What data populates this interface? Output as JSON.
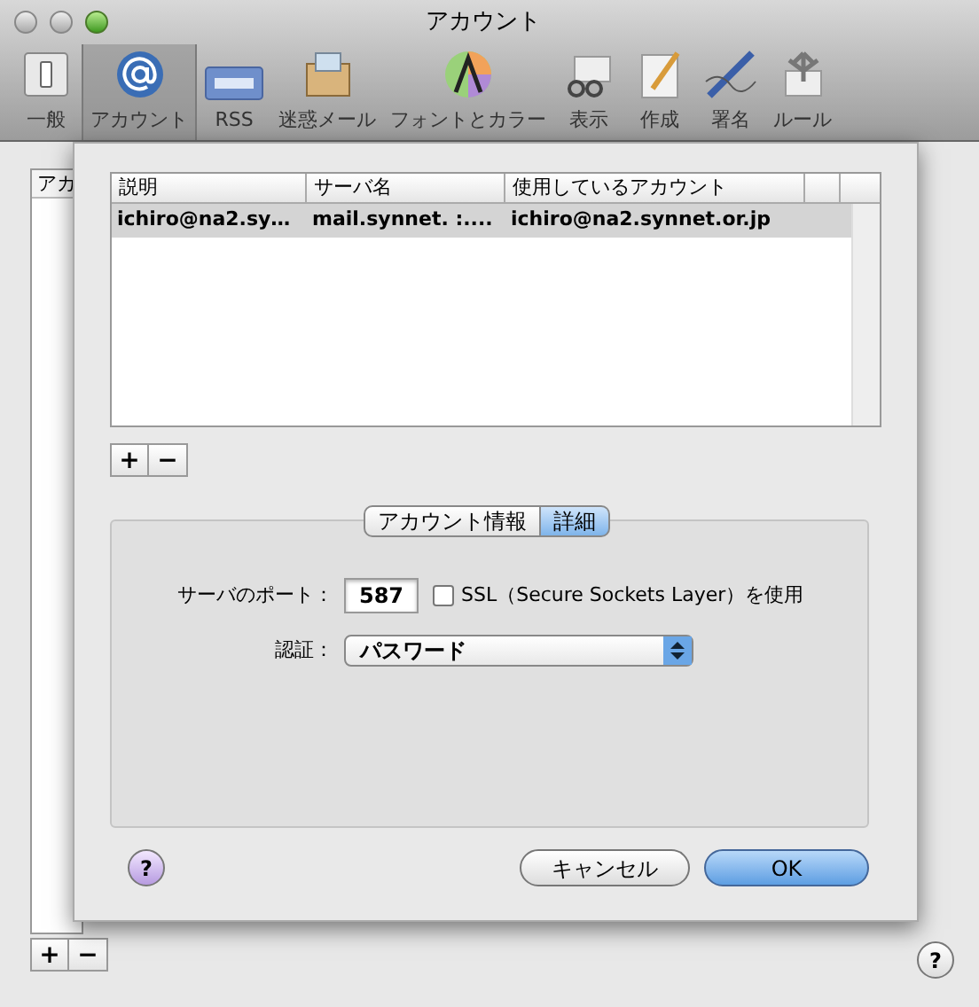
{
  "window": {
    "title": "アカウント"
  },
  "toolbar": [
    {
      "label": "一般",
      "selected": false
    },
    {
      "label": "アカウント",
      "selected": true
    },
    {
      "label": "RSS",
      "selected": false
    },
    {
      "label": "迷惑メール",
      "selected": false
    },
    {
      "label": "フォントとカラー",
      "selected": false
    },
    {
      "label": "表示",
      "selected": false
    },
    {
      "label": "作成",
      "selected": false
    },
    {
      "label": "署名",
      "selected": false
    },
    {
      "label": "ルール",
      "selected": false
    }
  ],
  "accounts_list": {
    "header": "アカ"
  },
  "sheet": {
    "table": {
      "columns": [
        "説明",
        "サーバ名",
        "使用しているアカウント"
      ],
      "rows": [
        {
          "cells": [
            "ichiro@na2.sy…",
            "mail.synnet. :....",
            "ichiro@na2.synnet.or.jp"
          ],
          "selected": true
        }
      ]
    },
    "add_button": "+",
    "remove_button": "−",
    "tabs": [
      {
        "label": "アカウント情報",
        "selected": false
      },
      {
        "label": "詳細",
        "selected": true
      }
    ],
    "port_label": "サーバのポート：",
    "port_value": "587",
    "ssl": {
      "label": "SSL（Secure Sockets Layer）を使用",
      "checked": false
    },
    "auth_label": "認証：",
    "auth_value": "パスワード",
    "help": "?",
    "cancel": "キャンセル",
    "ok": "OK"
  },
  "bottom": {
    "add_button": "+",
    "remove_button": "−",
    "help": "?"
  }
}
